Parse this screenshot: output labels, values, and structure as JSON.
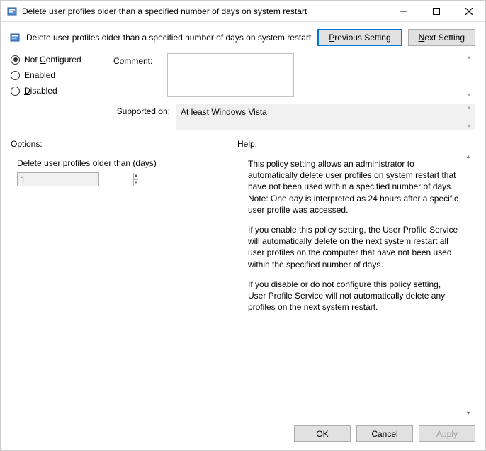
{
  "titlebar": {
    "title": "Delete user profiles older than a specified number of days on system restart"
  },
  "header": {
    "policy_title": "Delete user profiles older than a specified number of days on system restart",
    "previous_label": "Previous Setting",
    "previous_accesskey": "P",
    "next_label": "Next Setting",
    "next_accesskey": "N"
  },
  "state": {
    "not_configured": {
      "label": "Not Configured",
      "accesskey": "C",
      "selected": true
    },
    "enabled": {
      "label": "Enabled",
      "accesskey": "E",
      "selected": false
    },
    "disabled": {
      "label": "Disabled",
      "accesskey": "D",
      "selected": false
    }
  },
  "meta": {
    "comment_label": "Comment:",
    "comment_value": "",
    "supported_label": "Supported on:",
    "supported_value": "At least Windows Vista"
  },
  "labels": {
    "options": "Options:",
    "help": "Help:"
  },
  "options": {
    "setting_label": "Delete user profiles older than (days)",
    "setting_value": "1"
  },
  "help": {
    "p1": "This policy setting allows an administrator to automatically delete user profiles on system restart that have not been used within a specified number of days. Note: One day is interpreted as 24 hours after a specific user profile was accessed.",
    "p2": "If you enable this policy setting, the User Profile Service will automatically delete on the next system restart all user profiles on the computer that have not been used within the specified number of days.",
    "p3": "If you disable or do not configure this policy setting, User Profile Service will not automatically delete any profiles on the next system restart."
  },
  "footer": {
    "ok": "OK",
    "cancel": "Cancel",
    "apply": "Apply"
  }
}
